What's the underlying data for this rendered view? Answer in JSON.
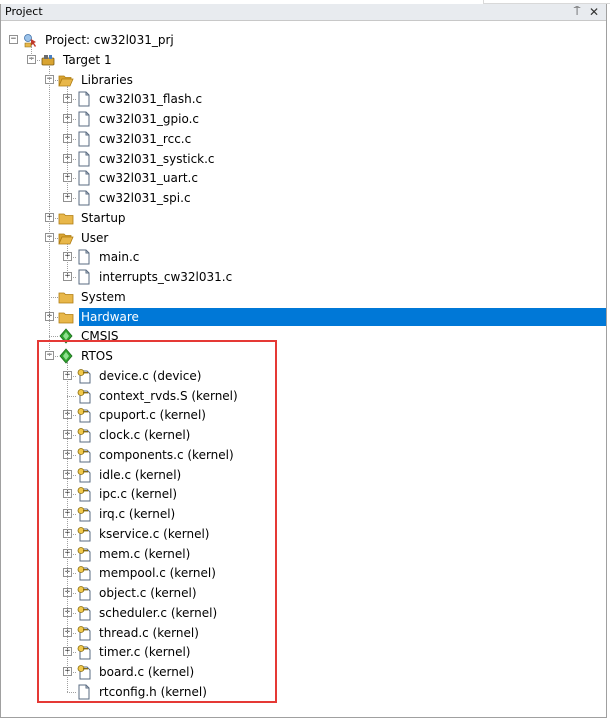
{
  "panel": {
    "title": "Project",
    "pin_glyph": "⍑",
    "close_glyph": "✕"
  },
  "colors": {
    "selection": "#0078d7",
    "highlight_border": "#e53935",
    "folder": "#e8b74a",
    "green_diamond": "#2fa32f"
  },
  "tree": [
    {
      "id": "project",
      "label": "Project: cw32l031_prj",
      "depth": 0,
      "icon": "project-icon",
      "expander": "minus"
    },
    {
      "id": "target",
      "label": "Target 1",
      "depth": 1,
      "icon": "target-icon",
      "expander": "minus"
    },
    {
      "id": "libraries",
      "label": "Libraries",
      "depth": 2,
      "icon": "folder-open-icon",
      "expander": "minus"
    },
    {
      "id": "lib-flash",
      "label": "cw32l031_flash.c",
      "depth": 3,
      "icon": "file-icon",
      "expander": "plus"
    },
    {
      "id": "lib-gpio",
      "label": "cw32l031_gpio.c",
      "depth": 3,
      "icon": "file-icon",
      "expander": "plus"
    },
    {
      "id": "lib-rcc",
      "label": "cw32l031_rcc.c",
      "depth": 3,
      "icon": "file-icon",
      "expander": "plus"
    },
    {
      "id": "lib-systick",
      "label": "cw32l031_systick.c",
      "depth": 3,
      "icon": "file-icon",
      "expander": "plus"
    },
    {
      "id": "lib-uart",
      "label": "cw32l031_uart.c",
      "depth": 3,
      "icon": "file-icon",
      "expander": "plus"
    },
    {
      "id": "lib-spi",
      "label": "cw32l031_spi.c",
      "depth": 3,
      "icon": "file-icon",
      "expander": "plus"
    },
    {
      "id": "startup",
      "label": "Startup",
      "depth": 2,
      "icon": "folder-icon",
      "expander": "plus"
    },
    {
      "id": "user",
      "label": "User",
      "depth": 2,
      "icon": "folder-open-icon",
      "expander": "minus"
    },
    {
      "id": "user-main",
      "label": "main.c",
      "depth": 3,
      "icon": "file-icon",
      "expander": "plus"
    },
    {
      "id": "user-interrupts",
      "label": "interrupts_cw32l031.c",
      "depth": 3,
      "icon": "file-icon",
      "expander": "plus"
    },
    {
      "id": "system",
      "label": "System",
      "depth": 2,
      "icon": "folder-icon",
      "expander": "none"
    },
    {
      "id": "hardware",
      "label": "Hardware",
      "depth": 2,
      "icon": "folder-icon",
      "expander": "plus",
      "selected": true
    },
    {
      "id": "cmsis",
      "label": "CMSIS",
      "depth": 2,
      "icon": "component-icon",
      "expander": "none"
    },
    {
      "id": "rtos",
      "label": "RTOS",
      "depth": 2,
      "icon": "component-icon",
      "expander": "minus"
    },
    {
      "id": "rtos-device",
      "label": "device.c (device)",
      "depth": 3,
      "icon": "keyfile-icon",
      "expander": "plus"
    },
    {
      "id": "rtos-context",
      "label": "context_rvds.S (kernel)",
      "depth": 3,
      "icon": "keyfile-icon",
      "expander": "none"
    },
    {
      "id": "rtos-cpuport",
      "label": "cpuport.c (kernel)",
      "depth": 3,
      "icon": "keyfile-icon",
      "expander": "plus"
    },
    {
      "id": "rtos-clock",
      "label": "clock.c (kernel)",
      "depth": 3,
      "icon": "keyfile-icon",
      "expander": "plus"
    },
    {
      "id": "rtos-components",
      "label": "components.c (kernel)",
      "depth": 3,
      "icon": "keyfile-icon",
      "expander": "plus"
    },
    {
      "id": "rtos-idle",
      "label": "idle.c (kernel)",
      "depth": 3,
      "icon": "keyfile-icon",
      "expander": "plus"
    },
    {
      "id": "rtos-ipc",
      "label": "ipc.c (kernel)",
      "depth": 3,
      "icon": "keyfile-icon",
      "expander": "plus"
    },
    {
      "id": "rtos-irq",
      "label": "irq.c (kernel)",
      "depth": 3,
      "icon": "keyfile-icon",
      "expander": "plus"
    },
    {
      "id": "rtos-kservice",
      "label": "kservice.c (kernel)",
      "depth": 3,
      "icon": "keyfile-icon",
      "expander": "plus"
    },
    {
      "id": "rtos-mem",
      "label": "mem.c (kernel)",
      "depth": 3,
      "icon": "keyfile-icon",
      "expander": "plus"
    },
    {
      "id": "rtos-mempool",
      "label": "mempool.c (kernel)",
      "depth": 3,
      "icon": "keyfile-icon",
      "expander": "plus"
    },
    {
      "id": "rtos-object",
      "label": "object.c (kernel)",
      "depth": 3,
      "icon": "keyfile-icon",
      "expander": "plus"
    },
    {
      "id": "rtos-scheduler",
      "label": "scheduler.c (kernel)",
      "depth": 3,
      "icon": "keyfile-icon",
      "expander": "plus"
    },
    {
      "id": "rtos-thread",
      "label": "thread.c (kernel)",
      "depth": 3,
      "icon": "keyfile-icon",
      "expander": "plus"
    },
    {
      "id": "rtos-timer",
      "label": "timer.c (kernel)",
      "depth": 3,
      "icon": "keyfile-icon",
      "expander": "plus"
    },
    {
      "id": "rtos-board",
      "label": "board.c (kernel)",
      "depth": 3,
      "icon": "keyfile-icon",
      "expander": "plus"
    },
    {
      "id": "rtos-rtconfig",
      "label": "rtconfig.h (kernel)",
      "depth": 3,
      "icon": "file-icon",
      "expander": "none"
    }
  ]
}
